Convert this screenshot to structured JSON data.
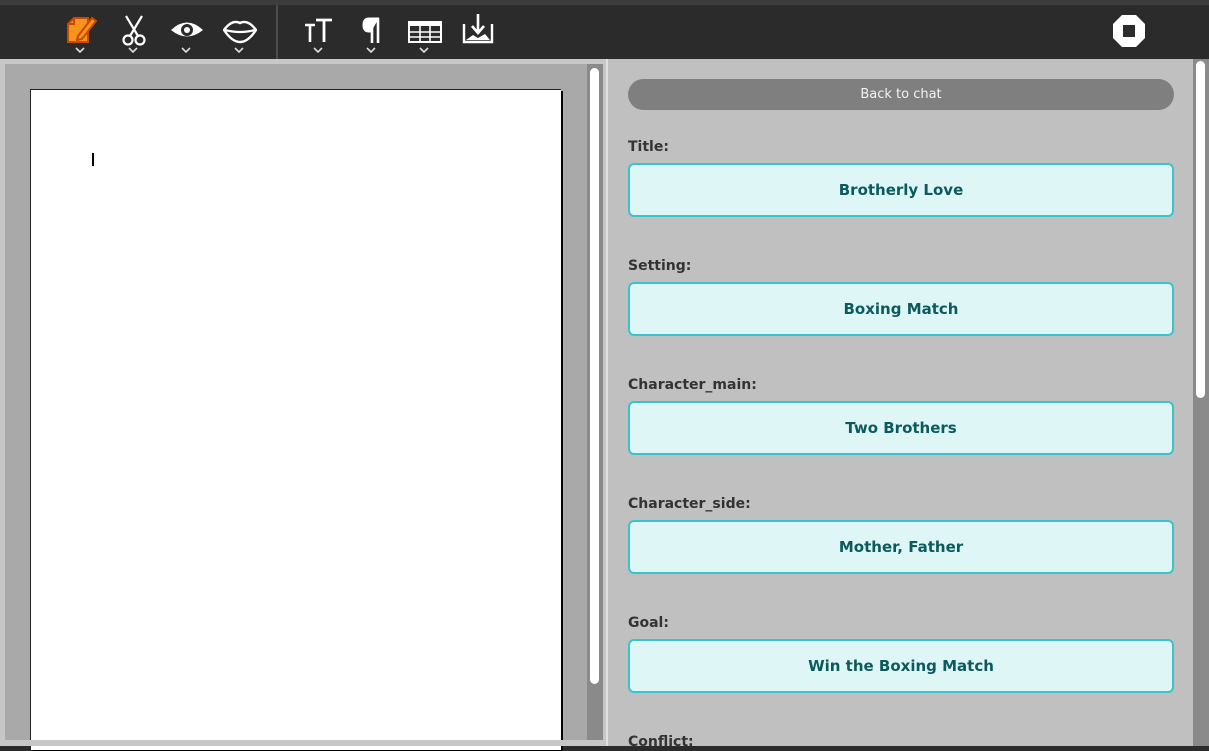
{
  "toolbar": {
    "tools": [
      {
        "icon": "edit-document-icon",
        "has_menu": true,
        "active_color": "#f7941d"
      },
      {
        "icon": "scissors-icon",
        "has_menu": true
      },
      {
        "icon": "eye-icon",
        "has_menu": true
      },
      {
        "icon": "lips-icon",
        "has_menu": true
      },
      {
        "icon": "text-size-icon",
        "has_menu": true
      },
      {
        "icon": "pilcrow-icon",
        "has_menu": true
      },
      {
        "icon": "table-icon",
        "has_menu": true
      },
      {
        "icon": "download-icon",
        "has_menu": false
      }
    ],
    "stop_icon": "stop-icon"
  },
  "editor": {
    "content": ""
  },
  "form": {
    "back_label": "Back to chat",
    "fields": [
      {
        "label": "Title:",
        "value": "Brotherly Love"
      },
      {
        "label": "Setting:",
        "value": "Boxing Match"
      },
      {
        "label": "Character_main:",
        "value": "Two Brothers"
      },
      {
        "label": "Character_side:",
        "value": "Mother, Father"
      },
      {
        "label": "Goal:",
        "value": "Win the Boxing Match"
      },
      {
        "label": "Conflict:",
        "value": ""
      }
    ]
  },
  "colors": {
    "accent_border": "#39c4cc",
    "field_bg": "#dff6f6",
    "field_text": "#0b5a5e",
    "toolbar_bg": "#2b2b2b"
  }
}
